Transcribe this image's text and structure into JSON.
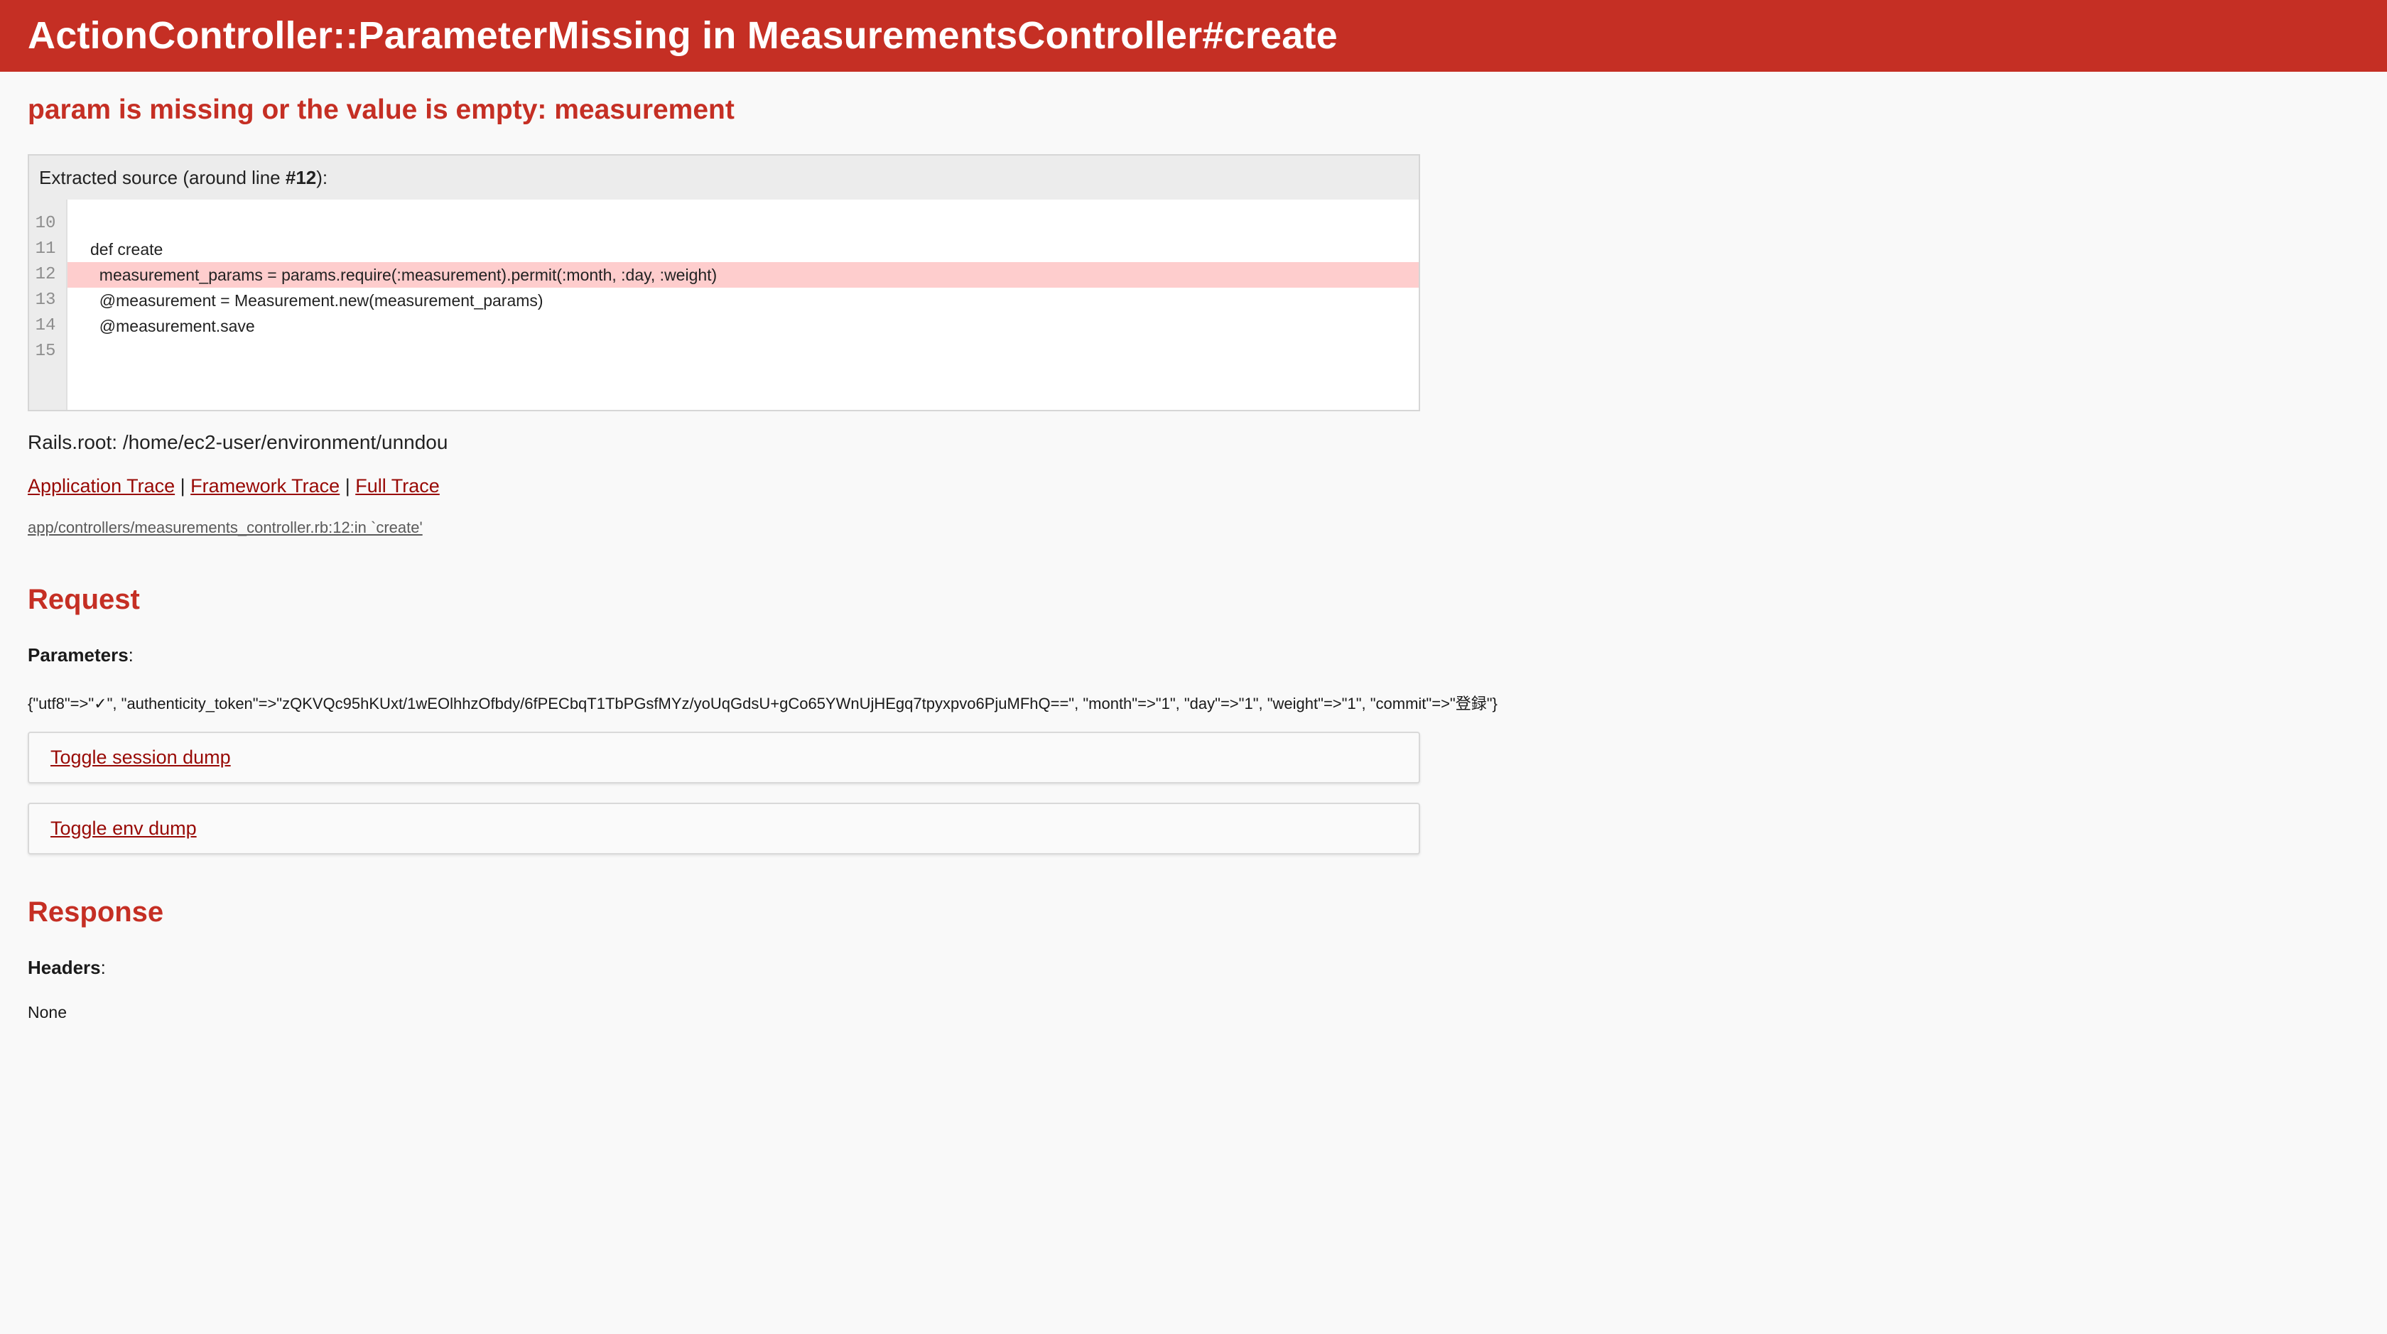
{
  "header": {
    "title": "ActionController::ParameterMissing in MeasurementsController#create"
  },
  "error_message": "param is missing or the value is empty: measurement",
  "source": {
    "heading_prefix": "Extracted source (around line ",
    "heading_line": "#12",
    "heading_suffix": "):",
    "lines": [
      {
        "num": "10",
        "code": ""
      },
      {
        "num": "11",
        "code": "def create"
      },
      {
        "num": "12",
        "code": "  measurement_params = params.require(:measurement).permit(:month, :day, :weight)"
      },
      {
        "num": "13",
        "code": "  @measurement = Measurement.new(measurement_params)"
      },
      {
        "num": "14",
        "code": "  @measurement.save"
      },
      {
        "num": "15",
        "code": ""
      }
    ],
    "highlight_line": "12"
  },
  "rails_root": "Rails.root: /home/ec2-user/environment/unndou",
  "trace": {
    "application": "Application Trace",
    "framework": "Framework Trace",
    "full": "Full Trace",
    "separator": " | ",
    "line": "app/controllers/measurements_controller.rb:12:in `create'"
  },
  "request": {
    "heading": "Request",
    "parameters_label": "Parameters",
    "parameters_value": "{\"utf8\"=>\"✓\", \"authenticity_token\"=>\"zQKVQc95hKUxt/1wEOlhhzOfbdy/6fPECbqT1TbPGsfMYz/yoUqGdsU+gCo65YWnUjHEgq7tpyxpvo6PjuMFhQ==\", \"month\"=>\"1\", \"day\"=>\"1\", \"weight\"=>\"1\", \"commit\"=>\"登録\"}",
    "session_toggle": "Toggle session dump",
    "env_toggle": "Toggle env dump"
  },
  "response": {
    "heading": "Response",
    "headers_label": "Headers",
    "headers_value": "None"
  },
  "colors": {
    "header_bg": "#c52f24",
    "link": "#980905",
    "highlight": "#fecdcd"
  }
}
